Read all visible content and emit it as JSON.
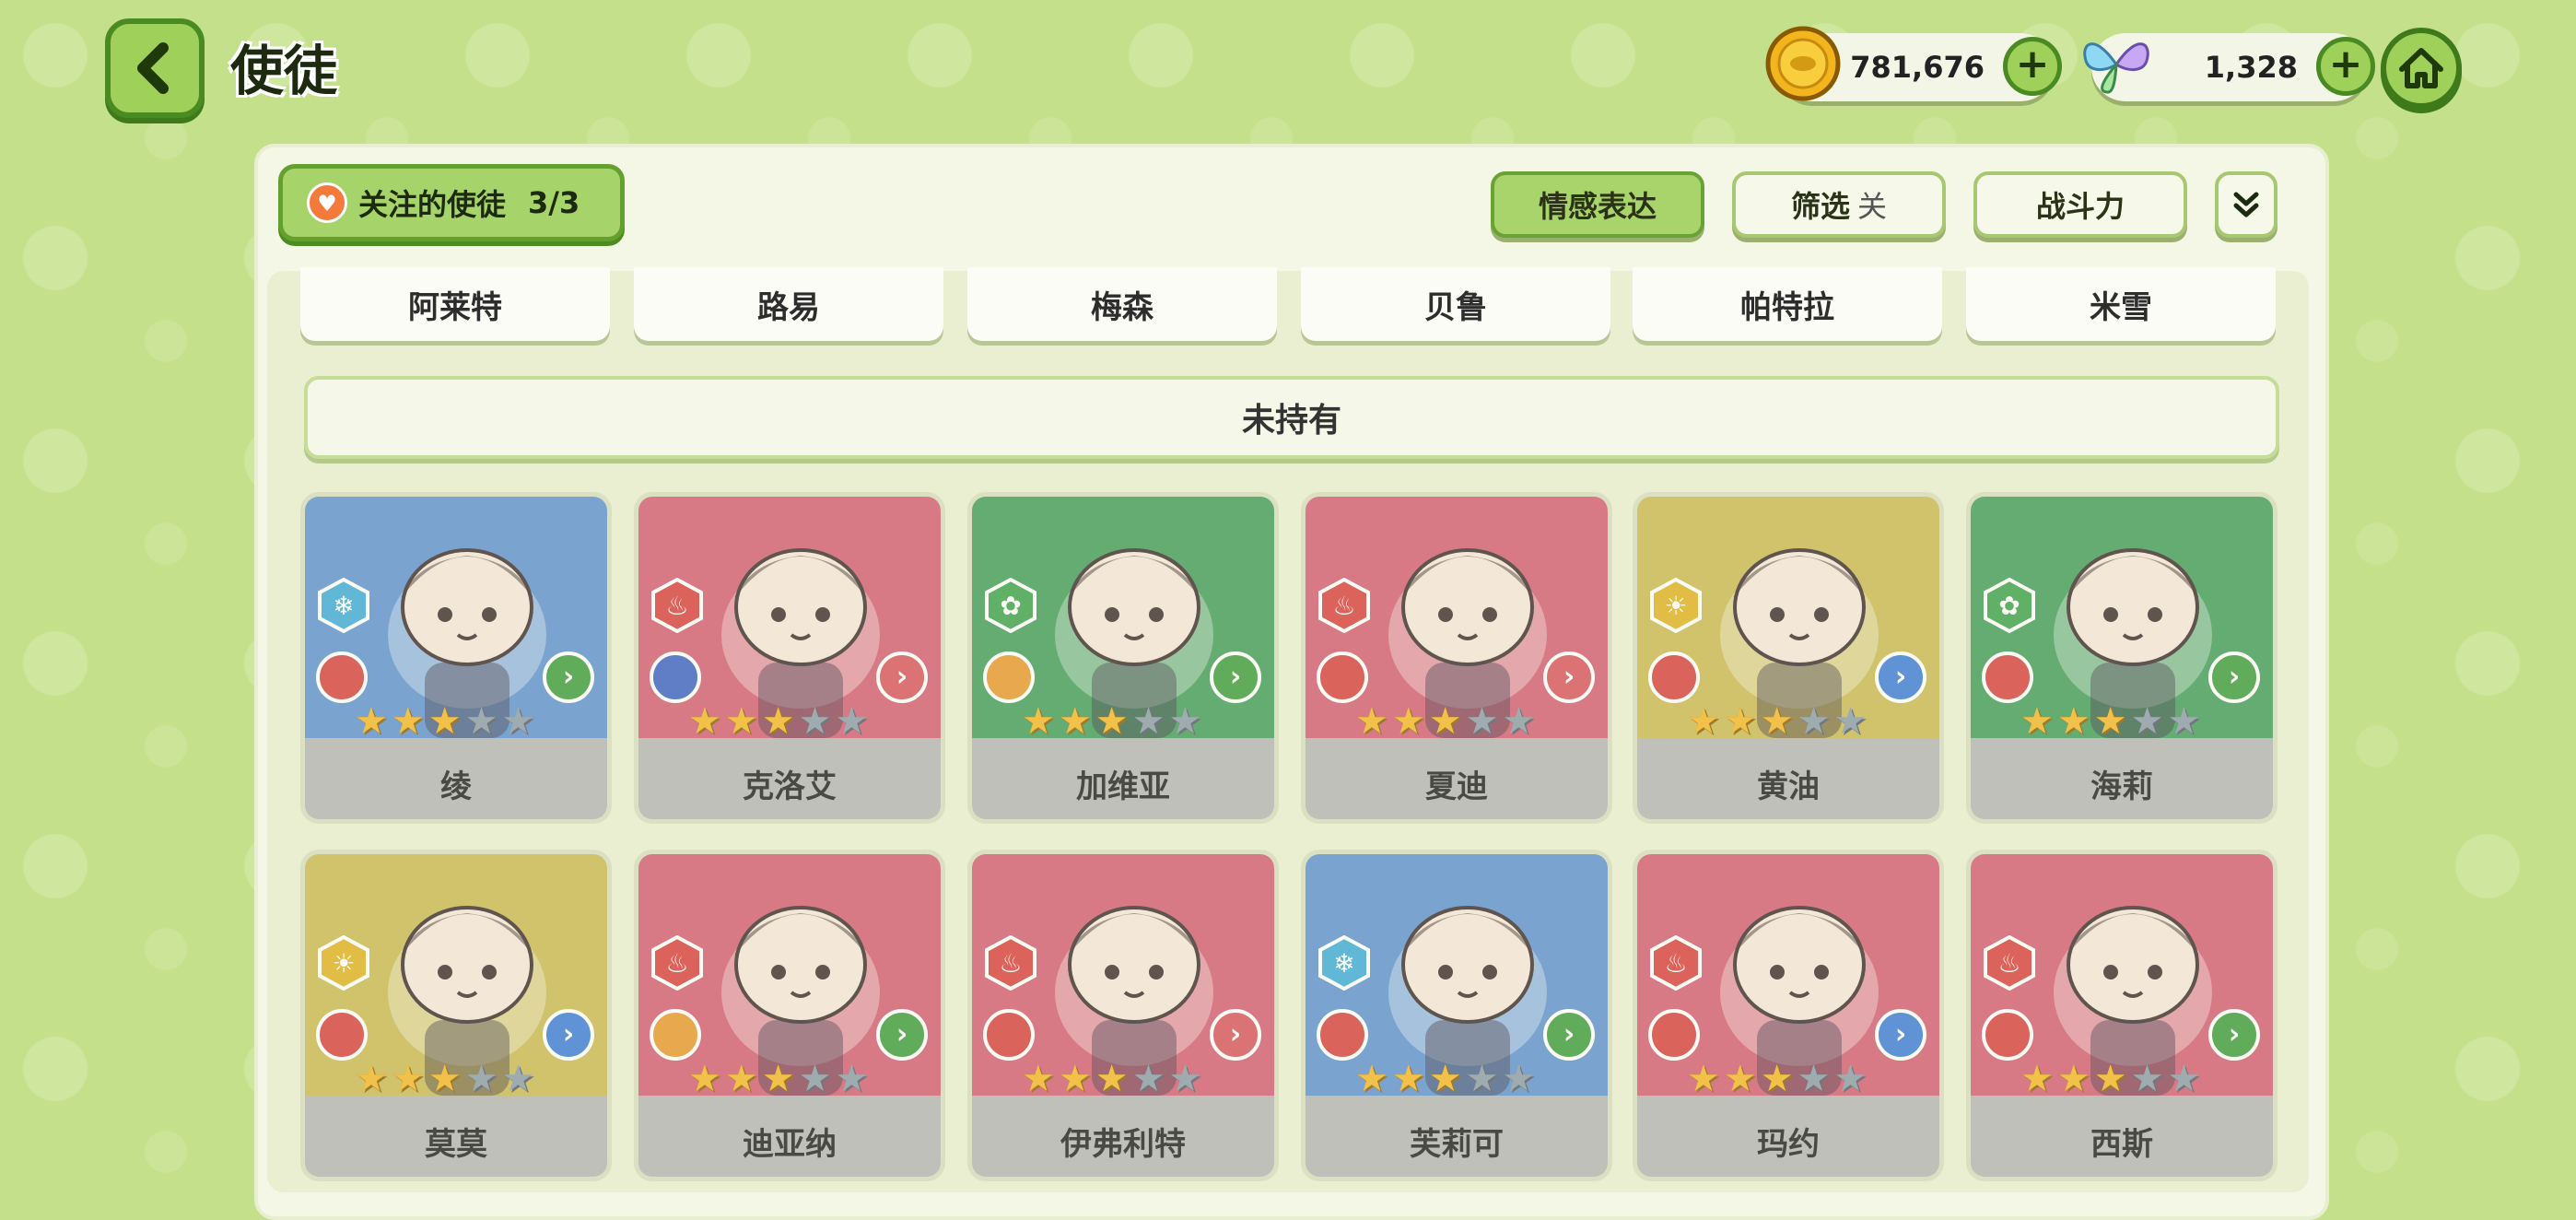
{
  "header": {
    "title": "使徒"
  },
  "currencies": {
    "gold": "781,676",
    "gems": "1,328"
  },
  "favorites": {
    "label": "关注的使徒",
    "count": "3/3"
  },
  "controls": {
    "emotion": "情感表达",
    "filter": "筛选",
    "filter_state": "关",
    "power": "战斗力"
  },
  "owned_names": [
    "阿莱特",
    "路易",
    "梅森",
    "贝鲁",
    "帕特拉",
    "米雪"
  ],
  "section": {
    "label": "未持有"
  },
  "colors": {
    "blue": "#5b8fcf",
    "red": "#d45a72",
    "green": "#3f9a58",
    "yellow": "#c9b750"
  },
  "cards": [
    {
      "name": "绫",
      "bg": "blue",
      "element": "ice",
      "stars": 3,
      "role": "red",
      "action": "green"
    },
    {
      "name": "克洛艾",
      "bg": "red",
      "element": "fire",
      "stars": 3,
      "role": "blue",
      "action": "red"
    },
    {
      "name": "加维亚",
      "bg": "green",
      "element": "wood",
      "stars": 3,
      "role": "orange",
      "action": "green"
    },
    {
      "name": "夏迪",
      "bg": "red",
      "element": "fire",
      "stars": 3,
      "role": "red",
      "action": "red"
    },
    {
      "name": "黄油",
      "bg": "yellow",
      "element": "light",
      "stars": 3,
      "role": "red",
      "action": "blue"
    },
    {
      "name": "海莉",
      "bg": "green",
      "element": "wood",
      "stars": 3,
      "role": "red",
      "action": "green"
    },
    {
      "name": "莫莫",
      "bg": "yellow",
      "element": "light",
      "stars": 3,
      "role": "red",
      "action": "blue"
    },
    {
      "name": "迪亚纳",
      "bg": "red",
      "element": "fire",
      "stars": 3,
      "role": "orange",
      "action": "green"
    },
    {
      "name": "伊弗利特",
      "bg": "red",
      "element": "fire",
      "stars": 3,
      "role": "red",
      "action": "red"
    },
    {
      "name": "芙莉可",
      "bg": "blue",
      "element": "ice",
      "stars": 3,
      "role": "red",
      "action": "green"
    },
    {
      "name": "玛约",
      "bg": "red",
      "element": "fire",
      "stars": 3,
      "role": "red",
      "action": "blue"
    },
    {
      "name": "西斯",
      "bg": "red",
      "element": "fire",
      "stars": 3,
      "role": "red",
      "action": "green"
    }
  ]
}
